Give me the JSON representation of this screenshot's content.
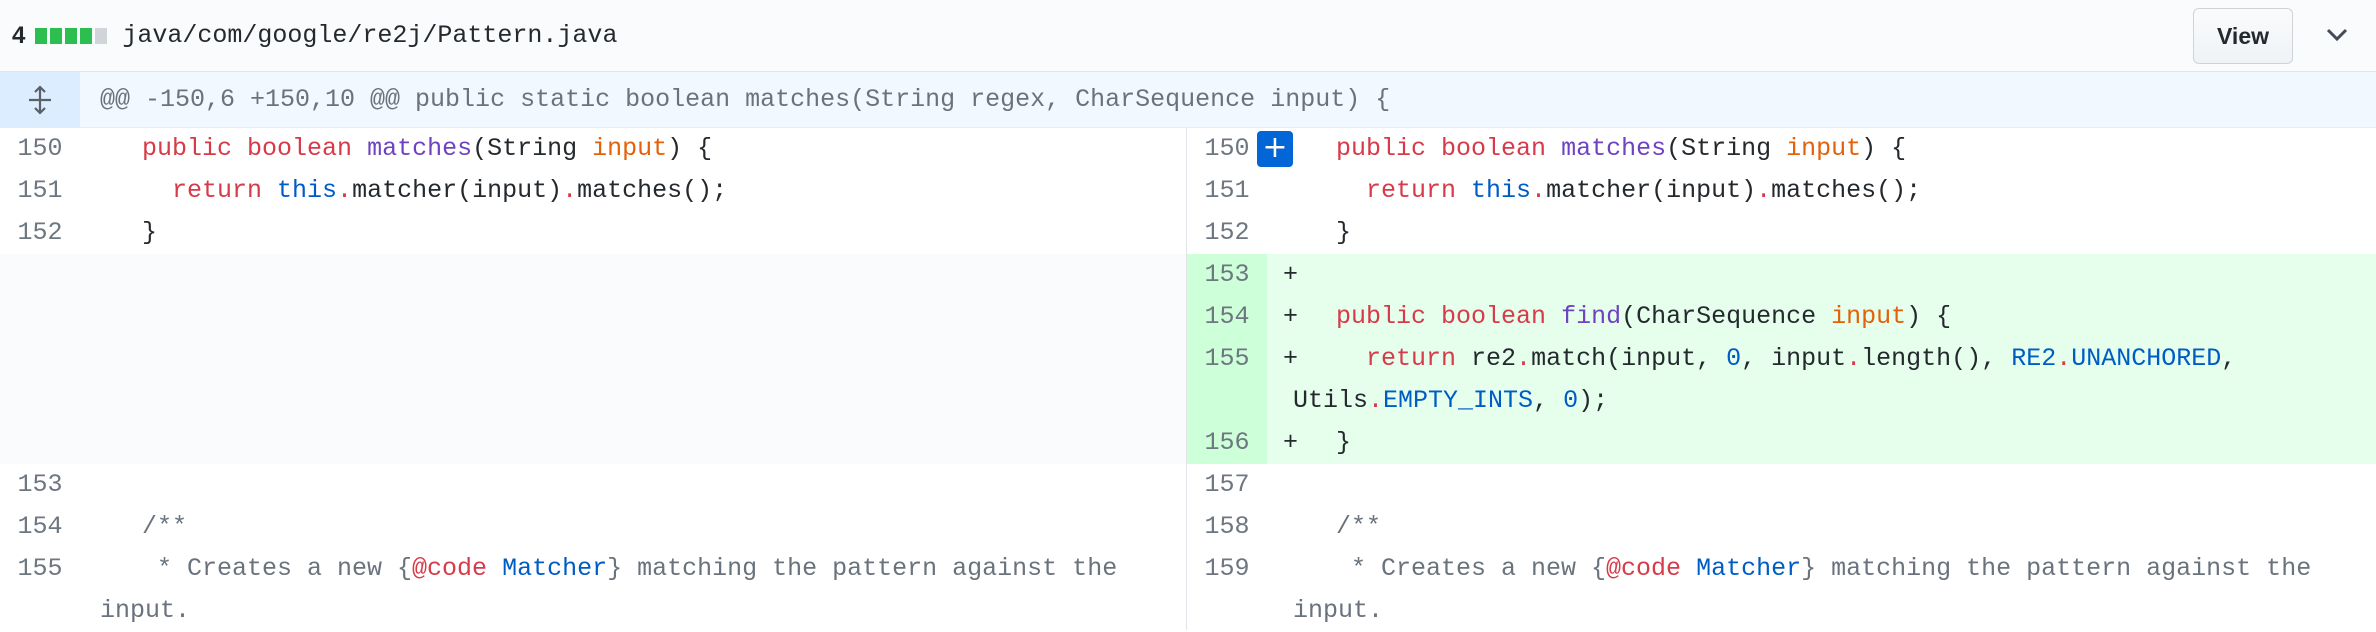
{
  "file": {
    "diffstat_count": "4",
    "diffstat_blocks": [
      "added",
      "added",
      "added",
      "added",
      "neutral"
    ],
    "path": "java/com/google/re2j/Pattern.java",
    "view_label": "View",
    "collapse_icon": "chevron-down-icon"
  },
  "hunk": {
    "expand_icon": "unfold-icon",
    "header": "@@ -150,6 +150,10 @@ public static boolean matches(String regex, CharSequence input) {"
  },
  "left": {
    "lines": [
      {
        "num": "150"
      },
      {
        "num": "151"
      },
      {
        "num": "152"
      },
      {
        "num": "153"
      },
      {
        "num": "154"
      },
      {
        "num": "155"
      }
    ]
  },
  "right": {
    "lines": [
      {
        "num": "150"
      },
      {
        "num": "151"
      },
      {
        "num": "152"
      },
      {
        "num": "153"
      },
      {
        "num": "154"
      },
      {
        "num": "155"
      },
      {
        "num": "156"
      },
      {
        "num": "157"
      },
      {
        "num": "158"
      },
      {
        "num": "159"
      }
    ]
  },
  "code": {
    "public": "public",
    "boolean": "boolean",
    "matches": "matches",
    "string_type": "String",
    "input": "input",
    "paren_brace": ") {",
    "return": "return",
    "this": "this",
    "dot": ".",
    "matcher_call": "matcher(input)",
    "matches_call": "matches();",
    "close_brace": "}",
    "plus": "+",
    "find": "find",
    "charseq": "CharSequence",
    "re2": "re2",
    "match_open": "match(input, ",
    "zero": "0",
    "comma_input": ", input",
    "length_call": "length(), ",
    "re2_const": "RE2",
    "unanchored": "UNANCHORED",
    "comma": ",",
    "utils": "Utils",
    "empty_ints": "EMPTY_INTS",
    "comma_space": ", ",
    "end_call": ");",
    "doc_open": "/**",
    "doc_star_text": " * Creates a new {",
    "doc_code_tag": "@code",
    "doc_matcher": "Matcher",
    "doc_rest": "} matching the pattern against the",
    "doc_input": "input."
  },
  "add_comment_icon": "plus-icon"
}
